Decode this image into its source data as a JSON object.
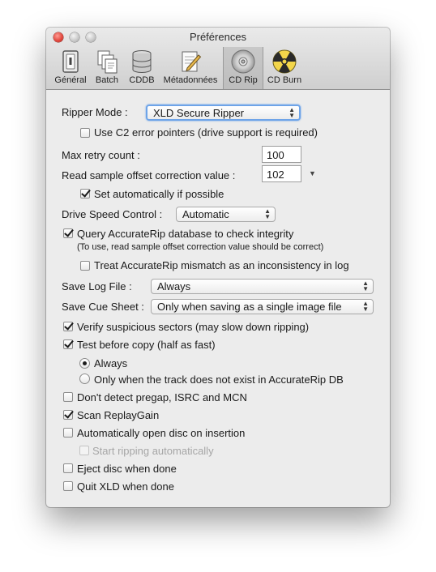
{
  "window": {
    "title": "Préférences"
  },
  "toolbar": {
    "items": [
      {
        "label": "Général",
        "icon": "general-icon"
      },
      {
        "label": "Batch",
        "icon": "batch-icon"
      },
      {
        "label": "CDDB",
        "icon": "database-icon"
      },
      {
        "label": "Métadonnées",
        "icon": "metadata-icon"
      },
      {
        "label": "CD Rip",
        "icon": "cd-icon",
        "selected": true
      },
      {
        "label": "CD Burn",
        "icon": "radioactive-icon"
      }
    ]
  },
  "ripper": {
    "mode_label": "Ripper Mode :",
    "mode_value": "XLD Secure Ripper",
    "c2_label": "Use C2 error pointers (drive support is required)",
    "c2_checked": false,
    "retry_label": "Max retry count :",
    "retry_value": "100",
    "offset_label": "Read sample offset correction value :",
    "offset_value": "102",
    "auto_offset_label": "Set automatically if possible",
    "auto_offset_checked": true,
    "speed_label": "Drive Speed Control :",
    "speed_value": "Automatic",
    "accuraterip_label": "Query AccurateRip database to check integrity",
    "accuraterip_checked": true,
    "accuraterip_note": "(To use, read sample offset correction value should be correct)",
    "mismatch_label": "Treat AccurateRip mismatch as an inconsistency in log",
    "mismatch_checked": false,
    "log_label": "Save Log File :",
    "log_value": "Always",
    "cue_label": "Save Cue Sheet :",
    "cue_value": "Only when saving as a single image file",
    "verify_label": "Verify suspicious sectors (may slow down ripping)",
    "verify_checked": true,
    "test_label": "Test before copy (half as fast)",
    "test_checked": true,
    "radio_always": "Always",
    "radio_only": "Only when the track does not exist in AccurateRip DB",
    "radio_selected": "always",
    "pregap_label": "Don't detect pregap, ISRC and MCN",
    "pregap_checked": false,
    "replaygain_label": "Scan ReplayGain",
    "replaygain_checked": true,
    "autoopen_label": "Automatically open disc on insertion",
    "autoopen_checked": false,
    "autostart_label": "Start ripping automatically",
    "autostart_checked": false,
    "autostart_enabled": false,
    "eject_label": "Eject disc when done",
    "eject_checked": false,
    "quit_label": "Quit XLD when done",
    "quit_checked": false
  }
}
